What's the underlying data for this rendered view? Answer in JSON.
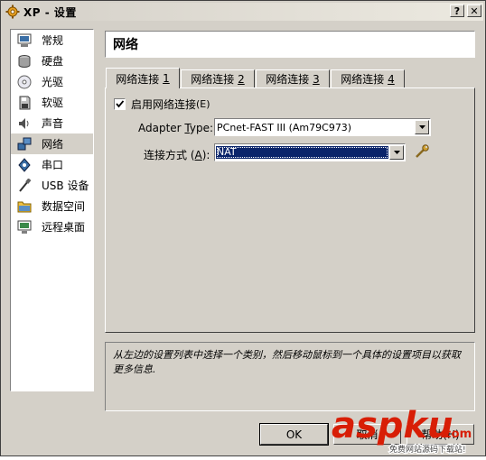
{
  "window": {
    "title": "XP - 设置"
  },
  "sidebar": {
    "items": [
      {
        "label": "常规",
        "icon": "monitor-icon"
      },
      {
        "label": "硬盘",
        "icon": "hard-disk-icon"
      },
      {
        "label": "光驱",
        "icon": "cdrom-icon"
      },
      {
        "label": "软驱",
        "icon": "floppy-icon"
      },
      {
        "label": "声音",
        "icon": "speaker-icon"
      },
      {
        "label": "网络",
        "icon": "network-icon",
        "selected": true
      },
      {
        "label": "串口",
        "icon": "serial-port-icon"
      },
      {
        "label": "USB 设备",
        "icon": "usb-icon"
      },
      {
        "label": "数据空间",
        "icon": "folder-icon"
      },
      {
        "label": "远程桌面",
        "icon": "remote-desktop-icon"
      }
    ]
  },
  "header": {
    "title": "网络"
  },
  "tabs": [
    {
      "label": "网络连接",
      "num": "1",
      "active": true
    },
    {
      "label": "网络连接",
      "num": "2"
    },
    {
      "label": "网络连接",
      "num": "3"
    },
    {
      "label": "网络连接",
      "num": "4"
    }
  ],
  "enable": {
    "label": "启用网络连接",
    "mnemonic": "(E)",
    "checked": true
  },
  "adapter": {
    "label_pre": "Adapter ",
    "label_ul": "T",
    "label_post": "ype:",
    "value": "PCnet-FAST III (Am79C973)"
  },
  "attach": {
    "label": "连接方式",
    "mnemonic_open": "(",
    "mnemonic": "A",
    "mnemonic_close": "):",
    "value": "NAT"
  },
  "info": {
    "text": "从左边的设置列表中选择一个类别，然后移动鼠标到一个具体的设置项目以获取更多信息."
  },
  "buttons": {
    "ok": "OK",
    "cancel": "取消",
    "help": "帮助(H)"
  },
  "watermark": {
    "brand": "aspku",
    "suffix": ".com",
    "tagline": "免费网站源码下载站!"
  },
  "colors": {
    "selection": "#0a246a",
    "face": "#d4d0c8",
    "watermark_red": "#d81e06"
  }
}
